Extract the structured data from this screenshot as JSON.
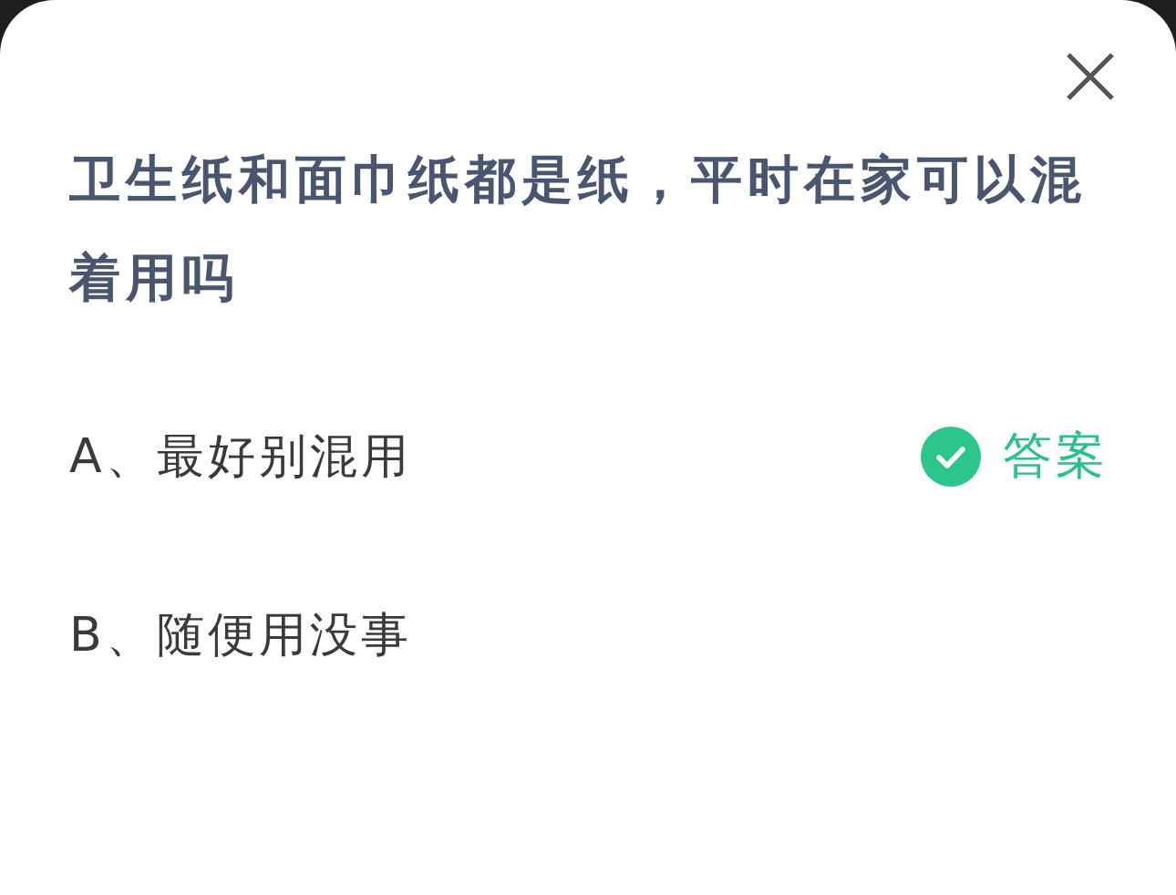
{
  "question": "卫生纸和面巾纸都是纸，平时在家可以混着用吗",
  "options": [
    {
      "label": "A、最好别混用",
      "correct": true,
      "badge": "答案"
    },
    {
      "label": "B、随便用没事",
      "correct": false
    }
  ]
}
